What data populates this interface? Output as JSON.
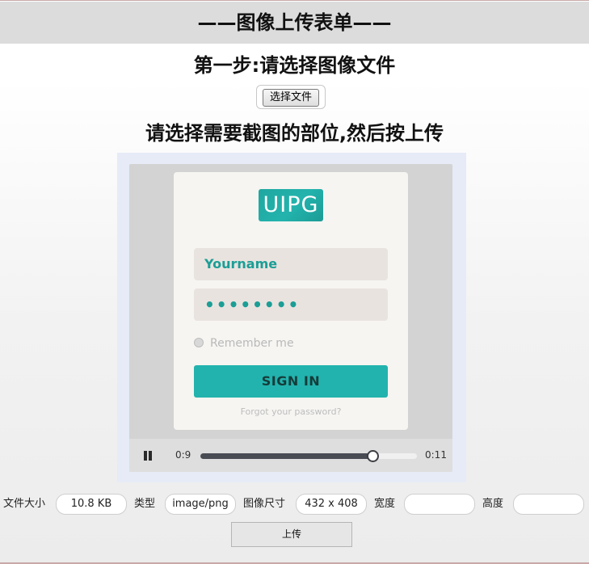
{
  "header": {
    "title": "——图像上传表单——"
  },
  "step1": {
    "title": "第一步:请选择图像文件",
    "file_button_label": "选择文件"
  },
  "step2": {
    "title": "请选择需要截图的部位,然后按上传"
  },
  "preview": {
    "login_card": {
      "logo_text": "UIPG",
      "username_value": "Yourname",
      "password_value": "••••••••",
      "remember_label": "Remember me",
      "signin_label": "SIGN IN",
      "forgot_label": "Forgot your password?"
    },
    "video": {
      "current_time": "0:9",
      "total_time": "0:11",
      "progress": 0.79,
      "pause_icon": "pause-icon"
    }
  },
  "info": {
    "file_size_label": "文件大小",
    "file_size_value": "10.8 KB",
    "type_label": "类型",
    "type_value": "image/png",
    "dimensions_label": "图像尺寸",
    "dimensions_value": "432 x 408",
    "width_label": "宽度",
    "width_value": "",
    "height_label": "高度",
    "height_value": ""
  },
  "actions": {
    "upload_label": "上传"
  },
  "colors": {
    "accent": "#22b3ae",
    "header_bg": "#dcdcdc",
    "crop_bg": "#e6ebf7"
  }
}
